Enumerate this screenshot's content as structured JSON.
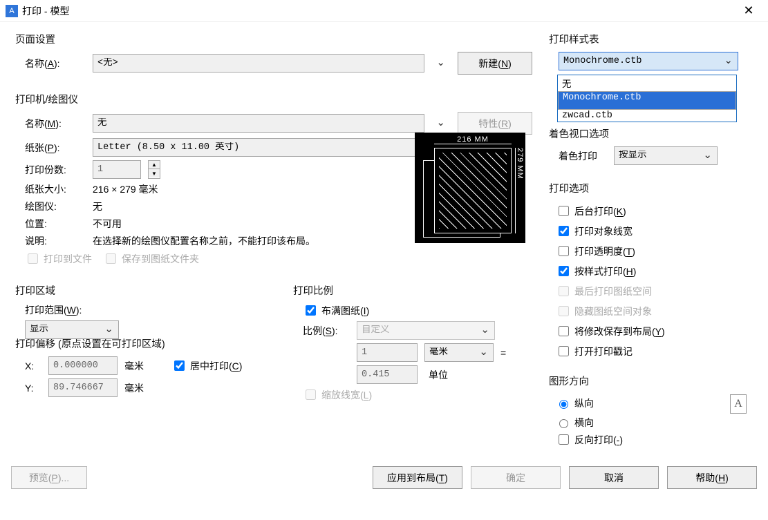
{
  "window": {
    "title": "打印 - 模型"
  },
  "page_setup": {
    "group_title": "页面设置",
    "name_label": "名称(A):",
    "name_value": "<无>",
    "new_btn": "新建(N)"
  },
  "printer": {
    "group_title": "打印机/绘图仪",
    "name_label": "名称(M):",
    "name_value": "无",
    "props_btn": "特性(R)",
    "paper_label": "纸张(P):",
    "paper_value": "Letter (8.50 x 11.00 英寸)",
    "copies_label": "打印份数:",
    "copies_value": "1",
    "paper_size_label": "纸张大小:",
    "paper_size_value": "216 × 279  毫米",
    "plotter_label": "绘图仪:",
    "plotter_value": "无",
    "where_label": "位置:",
    "where_value": "不可用",
    "desc_label": "说明:",
    "desc_value": "在选择新的绘图仪配置名称之前，不能打印该布局。",
    "to_file": "打印到文件",
    "save_to_folder": "保存到图纸文件夹",
    "preview_top": "216 MM",
    "preview_right": "279 MM"
  },
  "area": {
    "group_title": "打印区域",
    "what_label": "打印范围(W):",
    "what_value": "显示"
  },
  "offset": {
    "group_title": "打印偏移 (原点设置在可打印区域)",
    "x_label": "X:",
    "x_value": "0.000000",
    "x_unit": "毫米",
    "y_label": "Y:",
    "y_value": "89.746667",
    "y_unit": "毫米",
    "center": "居中打印(C)"
  },
  "scale": {
    "group_title": "打印比例",
    "fit": "布满图纸(I)",
    "scale_label": "比例(S):",
    "scale_value": "自定义",
    "num_value": "1",
    "unit_value": "毫米",
    "eq": "=",
    "den_value": "0.415",
    "den_unit": "单位",
    "scale_lw": "缩放线宽(L)"
  },
  "style": {
    "group_title": "打印样式表",
    "value": "Monochrome.ctb",
    "options": [
      "无",
      "Monochrome.ctb",
      "zwcad.ctb"
    ],
    "selected_index": 1
  },
  "shade": {
    "group_title": "着色视口选项",
    "label": "着色打印",
    "value": "按显示"
  },
  "options": {
    "group_title": "打印选项",
    "bg": "后台打印(K)",
    "lw": "打印对象线宽",
    "transp": "打印透明度(T)",
    "bystyle": "按样式打印(H)",
    "paperspace_last": "最后打印图纸空间",
    "hide_ps": "隐藏图纸空间对象",
    "save_changes": "将修改保存到布局(Y)",
    "stamp": "打开打印戳记"
  },
  "orient": {
    "group_title": "图形方向",
    "portrait": "纵向",
    "landscape": "横向",
    "upside": "反向打印(-)"
  },
  "buttons": {
    "preview": "预览(P)...",
    "apply": "应用到布局(T)",
    "ok": "确定",
    "cancel": "取消",
    "help": "帮助(H)"
  }
}
